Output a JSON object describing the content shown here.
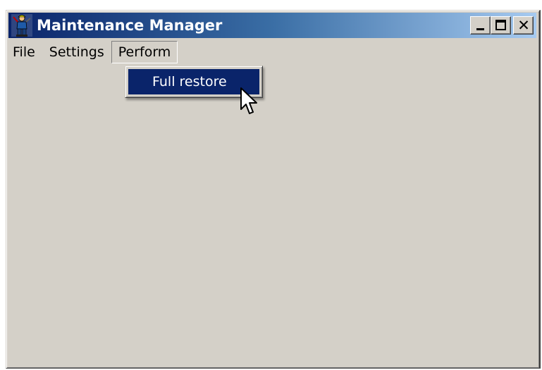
{
  "window": {
    "title": "Maintenance Manager",
    "icon": "maintenance-worker-icon",
    "caption_buttons": {
      "minimize_icon": "minimize-icon",
      "maximize_icon": "maximize-icon",
      "close_icon": "close-icon",
      "close_glyph": "✕"
    }
  },
  "menubar": {
    "items": [
      {
        "label": "File"
      },
      {
        "label": "Settings"
      },
      {
        "label": "Perform"
      }
    ]
  },
  "perform_menu": {
    "items": [
      {
        "label": "Full restore"
      }
    ]
  },
  "colors": {
    "title_gradient_start": "#0a246a",
    "title_gradient_end": "#a6caf0",
    "window_face": "#d4d0c8",
    "menu_highlight": "#0a246a"
  },
  "cursor": "arrow-cursor-icon"
}
